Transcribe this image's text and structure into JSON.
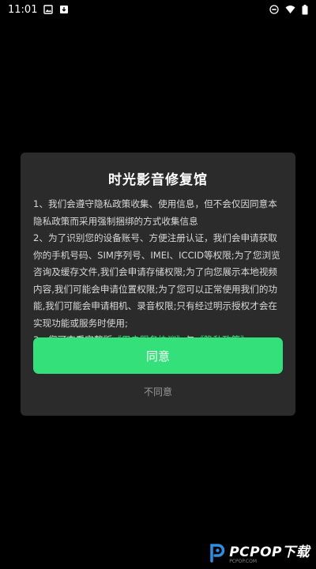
{
  "status_bar": {
    "time": "11:01",
    "left_icons": [
      "image-icon",
      "download-notification-icon"
    ],
    "right_icons": [
      "do-not-disturb-icon",
      "wifi-icon",
      "battery-icon"
    ]
  },
  "dialog": {
    "title": "时光影音修复馆",
    "paragraphs": {
      "p1": "1、我们会遵守隐私政策收集、使用信息，但不会仅因同意本隐私政策而采用强制捆绑的方式收集信息",
      "p2": "2、为了识别您的设备账号、方便注册认证，我们会申请获取你的手机号码、SIM序列号、IMEI、ICCID等权限;为了您浏览咨询及缓存文件,我们会申请存储权限;为了向您展示本地视频内容,我们可能会申请位置权限;为了您可以正常使用我们的功能,我们可能会申请相机、录音权限;只有经过明示授权才会在实现功能或服务时使用;",
      "p3_prefix": "3、您可查看完整版",
      "user_agreement_link": "《用户服务协议》",
      "p3_and": "与",
      "privacy_policy_link": "《隐私政策》"
    },
    "agree_label": "同意",
    "disagree_label": "不同意"
  },
  "watermark": {
    "brand": "PCPOP下载",
    "sub": "PCPOP.COM"
  },
  "colors": {
    "accent": "#33e07a",
    "link": "#3ee080",
    "dialog_bg": "#2b2b2b",
    "background": "#000000"
  }
}
